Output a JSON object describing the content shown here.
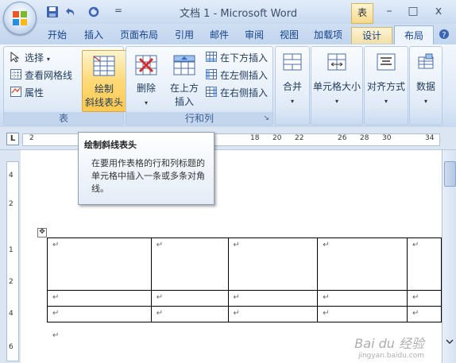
{
  "window": {
    "title": "文档 1 - Microsoft Word",
    "context_tab": "表",
    "minimize": "–",
    "maximize": "□",
    "close": "x",
    "qa_dropdown": "="
  },
  "tabs": [
    "开始",
    "插入",
    "页面布局",
    "引用",
    "邮件",
    "审阅",
    "视图",
    "加载项",
    "设计",
    "布局"
  ],
  "ribbon": {
    "table_group": {
      "label": "表",
      "select": "选择",
      "select_arrow": "▾",
      "gridlines": "查看网格线",
      "properties": "属性",
      "draw_diagonal_line1": "绘制",
      "draw_diagonal_line2": "斜线表头"
    },
    "rows_cols_group": {
      "label": "行和列",
      "delete": "删除",
      "insert_above_line1": "在上方",
      "insert_above_line2": "插入",
      "insert_below": "在下方插入",
      "insert_left": "在左侧插入",
      "insert_right": "在右侧插入",
      "dropdown_arrow": "▾",
      "launcher": "↘"
    },
    "merge": "合并",
    "cell_size": "单元格大小",
    "alignment": "对齐方式",
    "data": "数据",
    "dropdown_arrow": "▾"
  },
  "ruler": {
    "corner": "L",
    "ticks": [
      "2",
      "18",
      "20",
      "22",
      "26",
      "28",
      "30",
      "34"
    ]
  },
  "vruler": {
    "ticks": [
      "4",
      "2",
      "1",
      "2",
      "4",
      "6"
    ]
  },
  "tooltip": {
    "title": "绘制斜线表头",
    "body": "在要用作表格的行和列标题的单元格中插入一条或多条对角线。"
  },
  "document": {
    "cell_mark": "↵",
    "move_handle": "✥"
  },
  "watermark": {
    "main": "Bai du 经验",
    "sub": "jingyan.baidu.com"
  },
  "colors": {
    "ribbon_bg": "#dbe7f6",
    "active_button": "#ffd978",
    "title_text": "#3b4f6b"
  }
}
